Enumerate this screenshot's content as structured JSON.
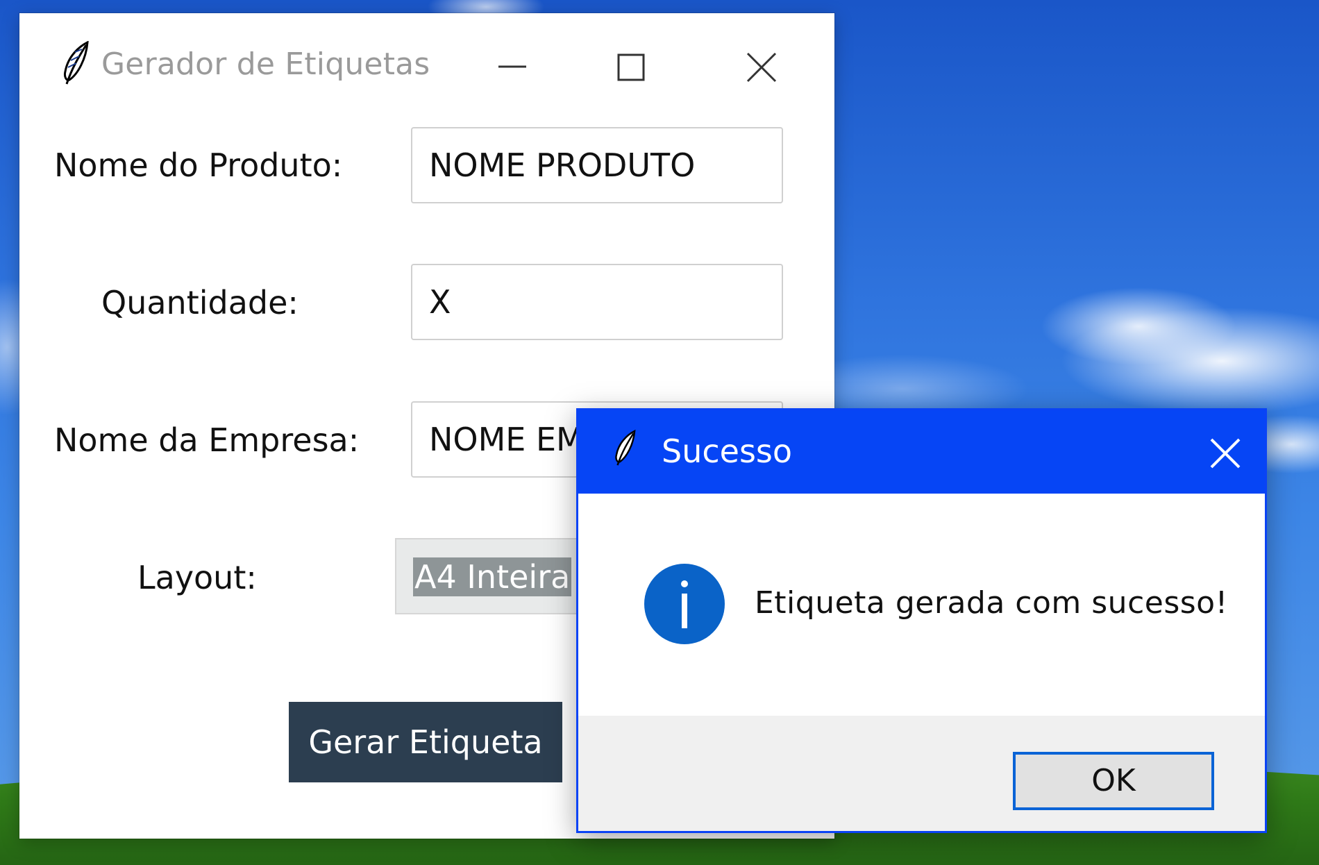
{
  "main_window": {
    "title": "Gerador de Etiquetas",
    "icon": "feather-icon",
    "fields": {
      "produto": {
        "label": "Nome do Produto:",
        "value": "NOME PRODUTO"
      },
      "quantidade": {
        "label": "Quantidade:",
        "value": "X"
      },
      "empresa": {
        "label": "Nome da Empresa:",
        "value": "NOME EMPRESA"
      },
      "layout": {
        "label": "Layout:",
        "value": "A4 Inteira"
      }
    },
    "generate_button": "Gerar Etiqueta"
  },
  "dialog": {
    "title": "Sucesso",
    "icon": "info-icon",
    "message": "Etiqueta gerada com sucesso!",
    "ok_button": "OK",
    "accent_color": "#0645f5"
  }
}
